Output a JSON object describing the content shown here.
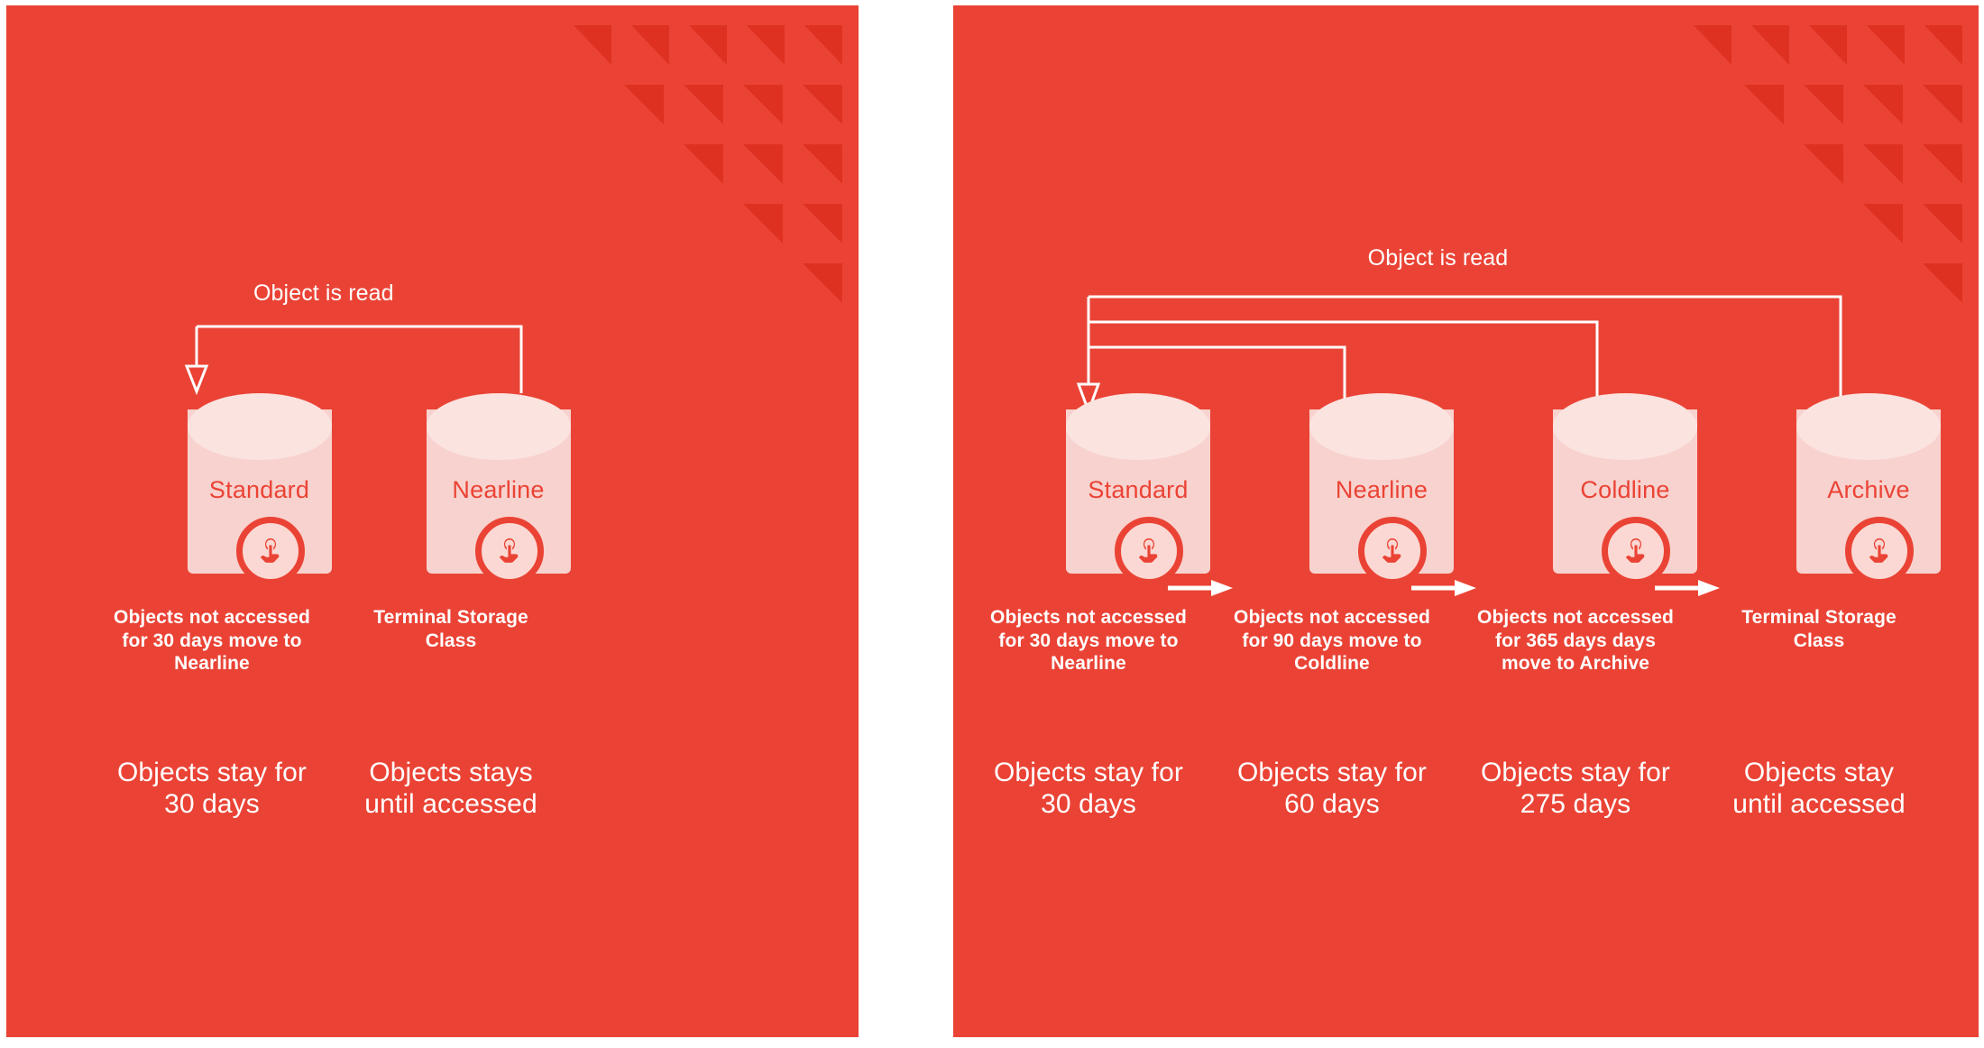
{
  "theme": {
    "panel_bg": "#EA4335",
    "panel_bg_alt": "#DE3122",
    "cylinder_body": "#F8D2CE",
    "cylinder_top": "#FBE3E0",
    "text_on_panel": "#FFFFFF",
    "cylinder_label": "#EA4335",
    "page_bg": "#FFFFFF"
  },
  "panels": [
    {
      "id": "two-class-lifecycle",
      "read_label": "Object is read",
      "columns": [
        {
          "name": "Standard",
          "icon": "touch-icon",
          "transition": "Objects not accessed for 30 days move to Nearline",
          "retention": "Objects stay for 30 days",
          "has_next_arrow": false
        },
        {
          "name": "Nearline",
          "icon": "touch-icon",
          "transition": "Terminal Storage Class",
          "retention": "Objects stays until accessed",
          "has_next_arrow": false
        }
      ]
    },
    {
      "id": "four-class-lifecycle",
      "read_label": "Object is read",
      "columns": [
        {
          "name": "Standard",
          "icon": "touch-icon",
          "transition": "Objects not accessed for 30 days move to Nearline",
          "retention": "Objects stay for 30 days",
          "has_next_arrow": true
        },
        {
          "name": "Nearline",
          "icon": "touch-icon",
          "transition": "Objects not accessed for 90 days move to Coldline",
          "retention": "Objects stay for 60 days",
          "has_next_arrow": true
        },
        {
          "name": "Coldline",
          "icon": "touch-icon",
          "transition": "Objects not accessed for 365 days days move to Archive",
          "retention": "Objects stay for 275 days",
          "has_next_arrow": true
        },
        {
          "name": "Archive",
          "icon": "touch-icon",
          "transition": "Terminal Storage Class",
          "retention": "Objects stay until accessed",
          "has_next_arrow": false
        }
      ]
    }
  ],
  "decor": {
    "triangle_rows": [
      5,
      4,
      3,
      2,
      1
    ]
  }
}
